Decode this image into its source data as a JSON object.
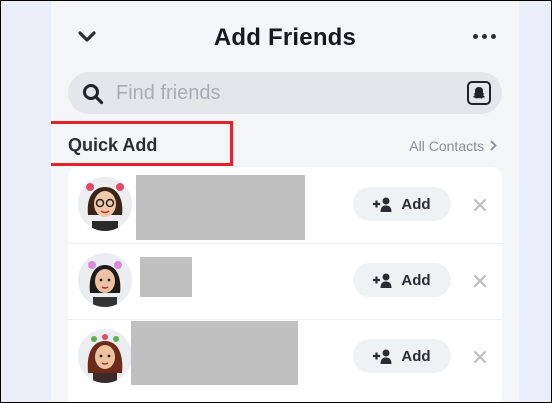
{
  "header": {
    "title": "Add Friends",
    "back_icon": "chevron-down-icon",
    "more_icon": "more-dots-icon"
  },
  "search": {
    "placeholder": "Find friends",
    "icon": "search-icon",
    "scan_icon": "snapcode-ghost-icon"
  },
  "quick_add": {
    "title": "Quick Add",
    "all_contacts_label": "All Contacts",
    "highlight_color": "#e3222b",
    "rows": [
      {
        "add_label": "Add",
        "avatar": "bitmoji-avatar-1"
      },
      {
        "add_label": "Add",
        "avatar": "bitmoji-avatar-2"
      },
      {
        "add_label": "Add",
        "avatar": "bitmoji-avatar-3"
      }
    ]
  },
  "colors": {
    "background": "#e9eef8",
    "panel": "#f4f5f7",
    "card": "#ffffff",
    "button": "#f0f1f3",
    "redaction": "#c0c0c0"
  }
}
